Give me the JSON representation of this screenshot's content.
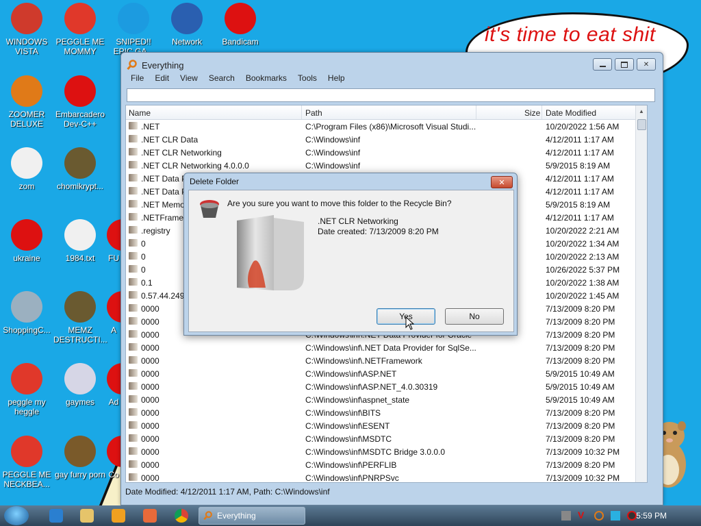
{
  "desktop": {
    "speech_text": "it's time to eat shit",
    "icons": [
      {
        "label": "WINDOWS VISTA",
        "color": "#cf3a2c"
      },
      {
        "label": "PEGGLE ME MOMMY",
        "color": "#e0382a"
      },
      {
        "label": "SNIPED!! EPIC GA...",
        "color": "#1c9be0"
      },
      {
        "label": "Network",
        "color": "#2a5fb0"
      },
      {
        "label": "Bandicam",
        "color": "#d11"
      },
      {
        "label": "ZOOMER DELUXE",
        "color": "#e07a18"
      },
      {
        "label": "Embarcadero Dev-C++",
        "color": "#d11"
      },
      {
        "label": "zom",
        "color": "#f0f0f0"
      },
      {
        "label": "chomikrypt...",
        "color": "#6a5a30"
      },
      {
        "label": "ukraine",
        "color": "#d11"
      },
      {
        "label": "1984.txt",
        "color": "#f0f0f0"
      },
      {
        "label": "FU",
        "color": "#d11"
      },
      {
        "label": "ShoppingC...",
        "color": "#9bb0c0"
      },
      {
        "label": "MEMZ DESTRUCTI...",
        "color": "#6a5a30"
      },
      {
        "label": "A",
        "color": "#d11"
      },
      {
        "label": "peggle my heggle",
        "color": "#e0382a"
      },
      {
        "label": "gaymes",
        "color": "#d6d6e6"
      },
      {
        "label": "Ad",
        "color": "#d11"
      },
      {
        "label": "PEGGLE ME NECKBEA...",
        "color": "#e0382a"
      },
      {
        "label": "gay furry porn",
        "color": "#7a5a2a"
      },
      {
        "label": "Co",
        "color": "#d11"
      }
    ]
  },
  "window": {
    "title": "Everything",
    "menu": [
      "File",
      "Edit",
      "View",
      "Search",
      "Bookmarks",
      "Tools",
      "Help"
    ],
    "search_value": "",
    "columns": {
      "name": "Name",
      "path": "Path",
      "size": "Size",
      "date": "Date Modified"
    },
    "rows": [
      {
        "name": ".NET",
        "path": "C:\\Program Files (x86)\\Microsoft Visual Studi...",
        "date": "10/20/2022 1:56 AM"
      },
      {
        "name": ".NET CLR Data",
        "path": "C:\\Windows\\inf",
        "date": "4/12/2011 1:17 AM"
      },
      {
        "name": ".NET CLR Networking",
        "path": "C:\\Windows\\inf",
        "date": "4/12/2011 1:17 AM"
      },
      {
        "name": ".NET CLR Networking 4.0.0.0",
        "path": "C:\\Windows\\inf",
        "date": "5/9/2015 8:19 AM"
      },
      {
        "name": ".NET Data Pr",
        "path": "",
        "date": "4/12/2011 1:17 AM"
      },
      {
        "name": ".NET Data Pr",
        "path": "",
        "date": "4/12/2011 1:17 AM"
      },
      {
        "name": ".NET Memor",
        "path": "",
        "date": "5/9/2015 8:19 AM"
      },
      {
        "name": ".NETFramew",
        "path": "",
        "date": "4/12/2011 1:17 AM"
      },
      {
        "name": ".registry",
        "path": "",
        "date": "10/20/2022 2:21 AM"
      },
      {
        "name": "0",
        "path": "",
        "date": "10/20/2022 1:34 AM"
      },
      {
        "name": "0",
        "path": "",
        "date": "10/20/2022 2:13 AM"
      },
      {
        "name": "0",
        "path": "",
        "date": "10/26/2022 5:37 PM"
      },
      {
        "name": "0.1",
        "path": "",
        "date": "10/20/2022 1:38 AM"
      },
      {
        "name": "0.57.44.2492",
        "path": "",
        "date": "10/20/2022 1:45 AM"
      },
      {
        "name": "0000",
        "path": "",
        "date": "7/13/2009 8:20 PM"
      },
      {
        "name": "0000",
        "path": "",
        "date": "7/13/2009 8:20 PM"
      },
      {
        "name": "0000",
        "path": "C:\\Windows\\inf\\.NET Data Provider for Oracle",
        "date": "7/13/2009 8:20 PM"
      },
      {
        "name": "0000",
        "path": "C:\\Windows\\inf\\.NET Data Provider for SqlSe...",
        "date": "7/13/2009 8:20 PM"
      },
      {
        "name": "0000",
        "path": "C:\\Windows\\inf\\.NETFramework",
        "date": "7/13/2009 8:20 PM"
      },
      {
        "name": "0000",
        "path": "C:\\Windows\\inf\\ASP.NET",
        "date": "5/9/2015 10:49 AM"
      },
      {
        "name": "0000",
        "path": "C:\\Windows\\inf\\ASP.NET_4.0.30319",
        "date": "5/9/2015 10:49 AM"
      },
      {
        "name": "0000",
        "path": "C:\\Windows\\inf\\aspnet_state",
        "date": "5/9/2015 10:49 AM"
      },
      {
        "name": "0000",
        "path": "C:\\Windows\\inf\\BITS",
        "date": "7/13/2009 8:20 PM"
      },
      {
        "name": "0000",
        "path": "C:\\Windows\\inf\\ESENT",
        "date": "7/13/2009 8:20 PM"
      },
      {
        "name": "0000",
        "path": "C:\\Windows\\inf\\MSDTC",
        "date": "7/13/2009 8:20 PM"
      },
      {
        "name": "0000",
        "path": "C:\\Windows\\inf\\MSDTC Bridge 3.0.0.0",
        "date": "7/13/2009 10:32 PM"
      },
      {
        "name": "0000",
        "path": "C:\\Windows\\inf\\PERFLIB",
        "date": "7/13/2009 8:20 PM"
      },
      {
        "name": "0000",
        "path": "C:\\Windows\\inf\\PNRPSvc",
        "date": "7/13/2009 10:32 PM"
      }
    ],
    "status": "Date Modified: 4/12/2011 1:17 AM, Path: C:\\Windows\\inf"
  },
  "dialog": {
    "title": "Delete Folder",
    "close_glyph": "✕",
    "question": "Are you sure you want to move this folder to the Recycle Bin?",
    "folder_name": ".NET CLR Networking",
    "folder_date": "Date created: 7/13/2009 8:20 PM",
    "yes_label": "Yes",
    "no_label": "No"
  },
  "taskbar": {
    "task_label": "Everything",
    "clock": "5:59 PM"
  }
}
